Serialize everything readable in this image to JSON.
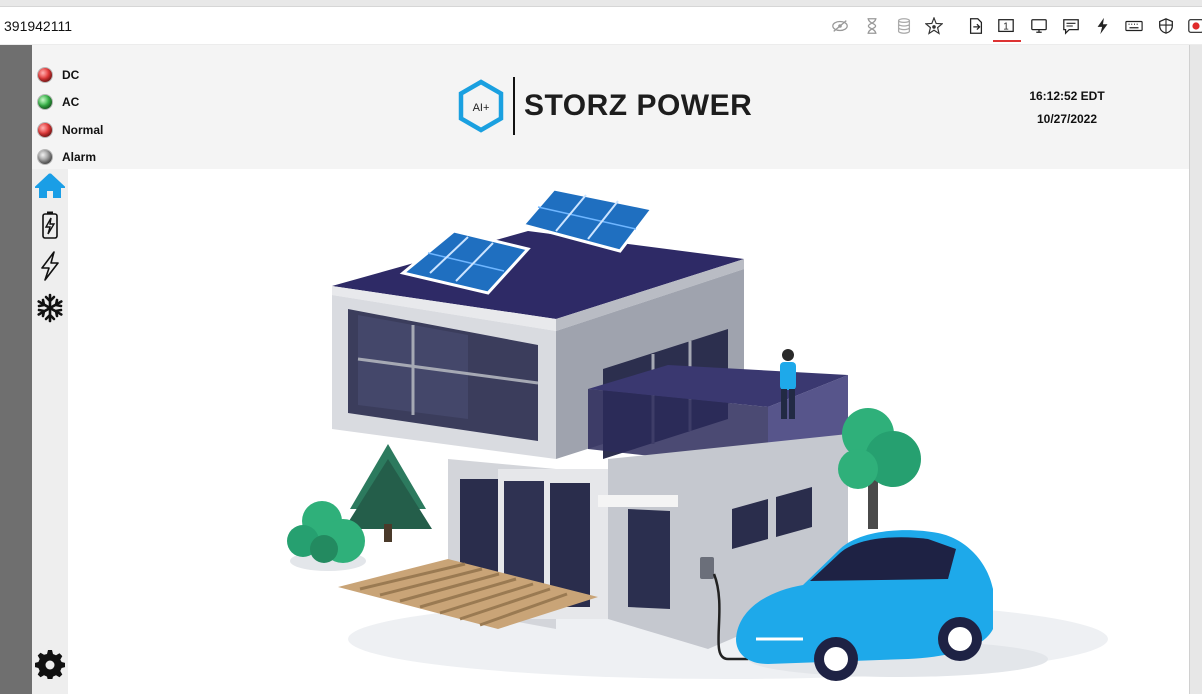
{
  "browser": {
    "address_text": "391942111",
    "toolbar_icons": [
      "eye-off-icon",
      "hourglass-icon",
      "database-icon",
      "star-icon",
      "export-icon",
      "page-number-icon",
      "monitor-icon",
      "comment-icon",
      "lightning-icon",
      "keyboard-icon",
      "shield-icon",
      "record-icon"
    ],
    "toolbar_page_number": "1"
  },
  "status": {
    "items": [
      {
        "label": "DC",
        "led": "red"
      },
      {
        "label": "AC",
        "led": "green"
      },
      {
        "label": "Normal",
        "led": "red"
      },
      {
        "label": "Alarm",
        "led": "gray"
      }
    ]
  },
  "brand": {
    "logo_text": "AI+",
    "name": "STORZ POWER",
    "logo_color": "#1aa0e0"
  },
  "clock": {
    "time": "16:12:52 EDT",
    "date": "10/27/2022"
  },
  "sidebar": {
    "items": [
      {
        "name": "home",
        "icon": "home-icon",
        "active": true
      },
      {
        "name": "battery",
        "icon": "battery-charging-icon"
      },
      {
        "name": "power",
        "icon": "lightning-bolt-icon"
      },
      {
        "name": "cooling",
        "icon": "snowflake-icon"
      },
      {
        "name": "settings",
        "icon": "gear-icon"
      }
    ]
  },
  "colors": {
    "accent_blue": "#1a9ee6",
    "roof_navy": "#2e2a66",
    "car_blue": "#1ea9ea",
    "tree_green": "#2fb07a"
  }
}
